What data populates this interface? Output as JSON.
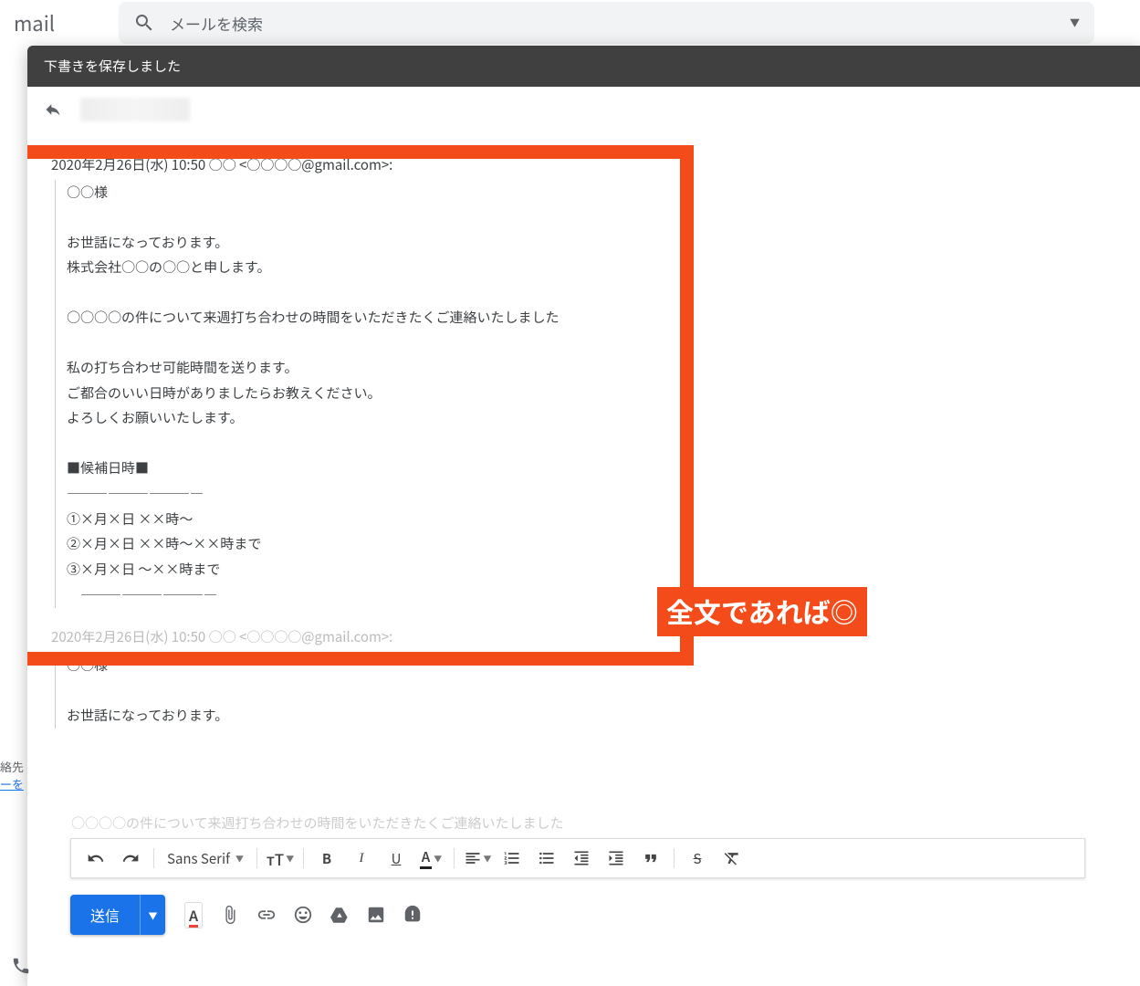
{
  "top": {
    "logo": "mail",
    "search_placeholder": "メールを検索"
  },
  "compose": {
    "title": "下書きを保存しました"
  },
  "mail": {
    "quote_header": "2020年2月26日(水) 10:50 ○○ <○○○○@gmail.com>:",
    "line1": "○○様",
    "line2": "お世話になっております。",
    "line3": "株式会社○○の○○と申します。",
    "line4": "○○○○の件について来週打ち合わせの時間をいただきたくご連絡いたしました",
    "line5": "私の打ち合わせ可能時間を送ります。",
    "line6": "ご都合のいい日時がありましたらお教えください。",
    "line7": "よろしくお願いいたします。",
    "line8": "■候補日時■",
    "line9": "――――――――――",
    "line10": "①×月×日 ××時～",
    "line11": "②×月×日 ××時～××時まで",
    "line12": "③×月×日 ～××時まで",
    "line13": "　――――――――――"
  },
  "annotation": "全文であれば◎",
  "mail2": {
    "quote_header": "2020年2月26日(水) 10:50 ○○ <○○○○@gmail.com>:",
    "line1": "○○様",
    "line2": "お世話になっております。"
  },
  "toolbar": {
    "font": "Sans Serif",
    "size_glyph": "тT",
    "bold": "B",
    "italic": "I",
    "underline": "U",
    "color": "A",
    "strike": "S"
  },
  "truncated": "○○○○の件について来週打ち合わせの時間をいただきたくご連絡いたしました",
  "sidebar": {
    "txt1": "絡先",
    "txt2": "ーを"
  },
  "send": {
    "label": "送信"
  }
}
